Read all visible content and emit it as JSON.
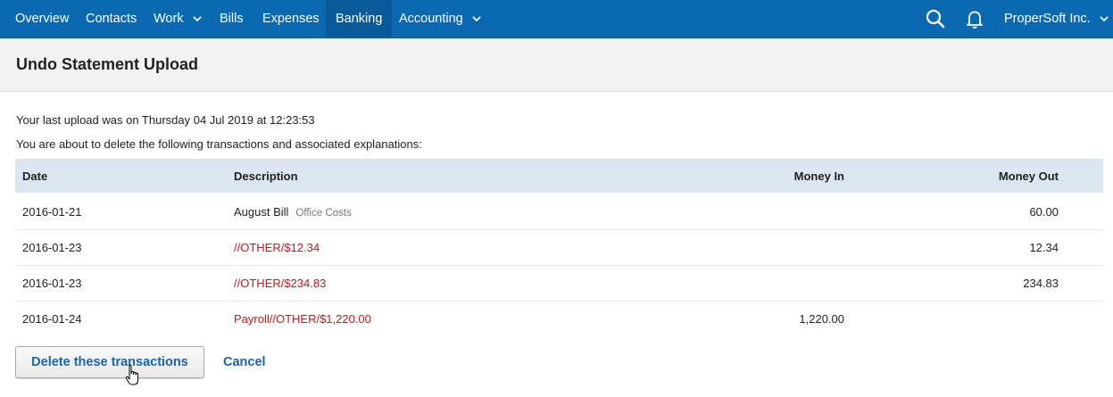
{
  "nav": {
    "items": [
      {
        "label": "Overview"
      },
      {
        "label": "Contacts"
      },
      {
        "label": "Work"
      },
      {
        "label": "Bills"
      },
      {
        "label": "Expenses"
      },
      {
        "label": "Banking"
      },
      {
        "label": "Accounting"
      }
    ],
    "active": "Banking",
    "account_label": "ProperSoft Inc.",
    "icons": [
      "search-icon",
      "bell-icon",
      "chevron-down-icon"
    ]
  },
  "page": {
    "title": "Undo Statement Upload",
    "last_upload": "Your last upload was on Thursday 04 Jul 2019 at 12:23:53",
    "warning": "You are about to delete the following transactions and associated explanations:"
  },
  "table": {
    "columns": [
      "Date",
      "Description",
      "Money In",
      "Money Out"
    ],
    "rows": [
      {
        "date": "2016-01-21",
        "description": "August Bill",
        "category": "Office Costs",
        "money_in": "",
        "money_out": "60.00"
      },
      {
        "date": "2016-01-23",
        "description": "//OTHER/$12.34",
        "category": "",
        "money_in": "",
        "money_out": "12.34"
      },
      {
        "date": "2016-01-23",
        "description": "//OTHER/$234.83",
        "category": "",
        "money_in": "",
        "money_out": "234.83"
      },
      {
        "date": "2016-01-24",
        "description": "Payroll//OTHER/$1,220.00",
        "category": "",
        "money_in": "1,220.00",
        "money_out": ""
      }
    ]
  },
  "actions": {
    "delete_label": "Delete these transactions",
    "cancel_label": "Cancel"
  },
  "colors": {
    "nav_bg": "#0a69b0",
    "nav_active": "#085a98",
    "link": "#1565b0",
    "unexplained": "#c4161c",
    "header_row": "#dbe6f0"
  }
}
